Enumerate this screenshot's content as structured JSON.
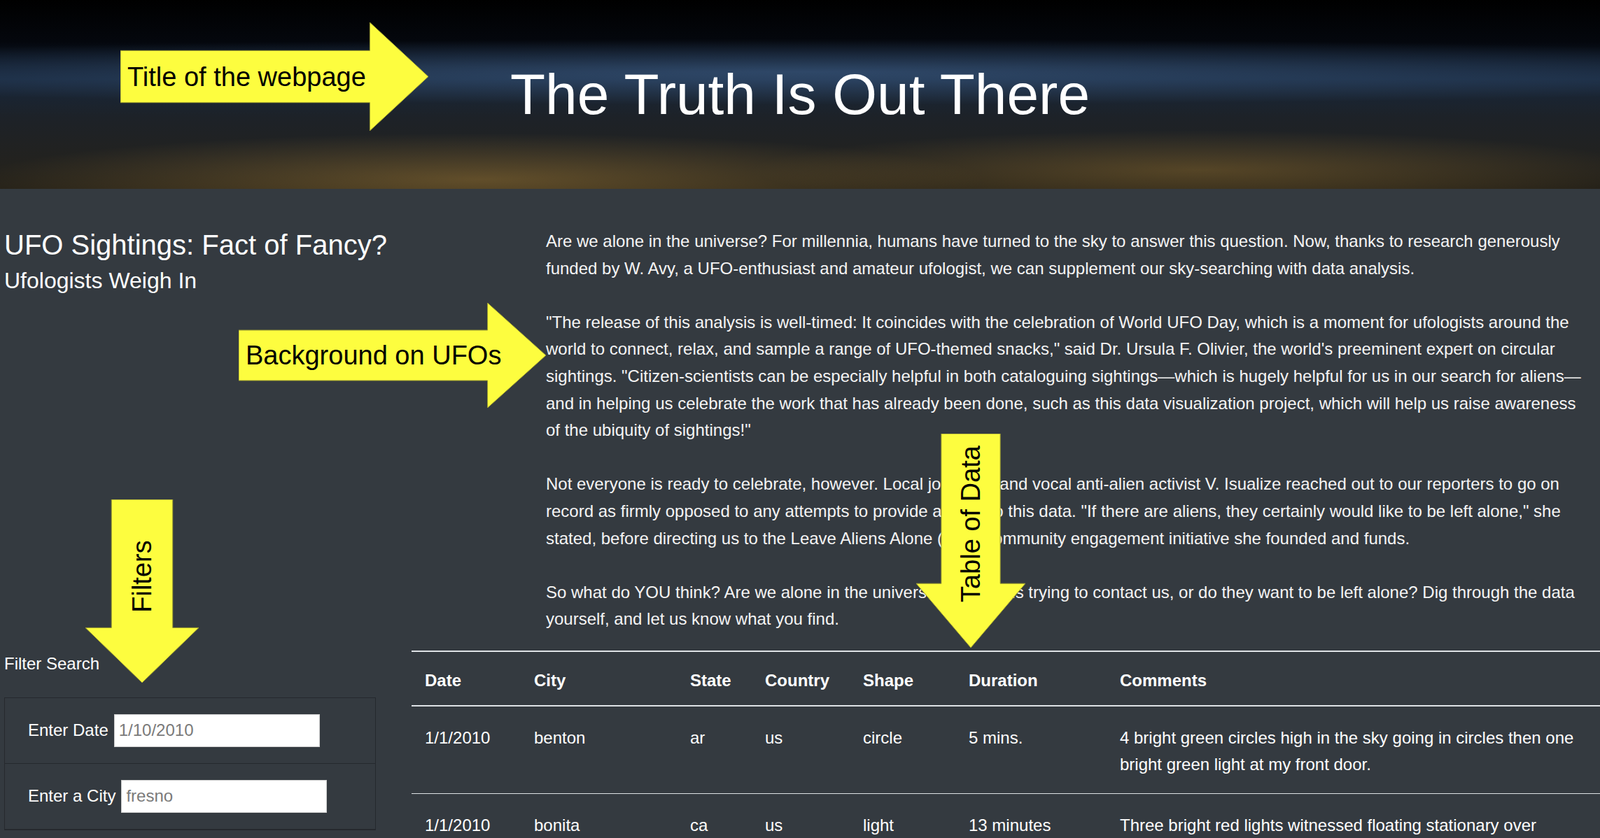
{
  "header": {
    "title": "The Truth Is Out There"
  },
  "intro": {
    "title": "UFO Sightings: Fact of Fancy?",
    "subtitle": "Ufologists Weigh In"
  },
  "article": {
    "paragraphs": [
      "Are we alone in the universe? For millennia, humans have turned to the sky to answer this question. Now, thanks to research generously funded by W. Avy, a UFO-enthusiast and amateur ufologist, we can supplement our sky-searching with data analysis.",
      "\"The release of this analysis is well-timed: It coincides with the celebration of World UFO Day, which is a moment for ufologists around the world to connect, relax, and sample a range of UFO-themed snacks,\" said Dr. Ursula F. Olivier, the world's preeminent expert on circular sightings. \"Citizen-scientists can be especially helpful in both cataloguing sightings—which is hugely helpful for us in our search for aliens—and in helping us celebrate the work that has already been done, such as this data visualization project, which will help us raise awareness of the ubiquity of sightings!\"",
      "Not everyone is ready to celebrate, however. Local journalist and vocal anti-alien activist V. Isualize reached out to our reporters to go on record as firmly opposed to any attempts to provide access to this data. \"If there are aliens, they certainly would like to be left alone,\" she stated, before directing us to the Leave Aliens Alone (LAA) community engagement initiative she founded and funds.",
      "So what do YOU think? Are we alone in the universe? Are aliens trying to contact us, or do they want to be left alone? Dig through the data yourself, and let us know what you find."
    ]
  },
  "filters": {
    "title": "Filter Search",
    "fields": [
      {
        "label": "Enter Date",
        "placeholder": "1/10/2010"
      },
      {
        "label": "Enter a City",
        "placeholder": "fresno"
      }
    ]
  },
  "table": {
    "columns": [
      "Date",
      "City",
      "State",
      "Country",
      "Shape",
      "Duration",
      "Comments"
    ],
    "rows": [
      [
        "1/1/2010",
        "benton",
        "ar",
        "us",
        "circle",
        "5 mins.",
        "4 bright green circles high in the sky going in circles then one bright green light at my front door."
      ],
      [
        "1/1/2010",
        "bonita",
        "ca",
        "us",
        "light",
        "13 minutes",
        "Three bright red lights witnessed floating stationary over"
      ]
    ]
  },
  "annotations": [
    {
      "text": "Title of the webpage",
      "kind": "right"
    },
    {
      "text": "Background on UFOs",
      "kind": "right"
    },
    {
      "text": "Filters",
      "kind": "down"
    },
    {
      "text": "Table of Data",
      "kind": "down"
    }
  ]
}
